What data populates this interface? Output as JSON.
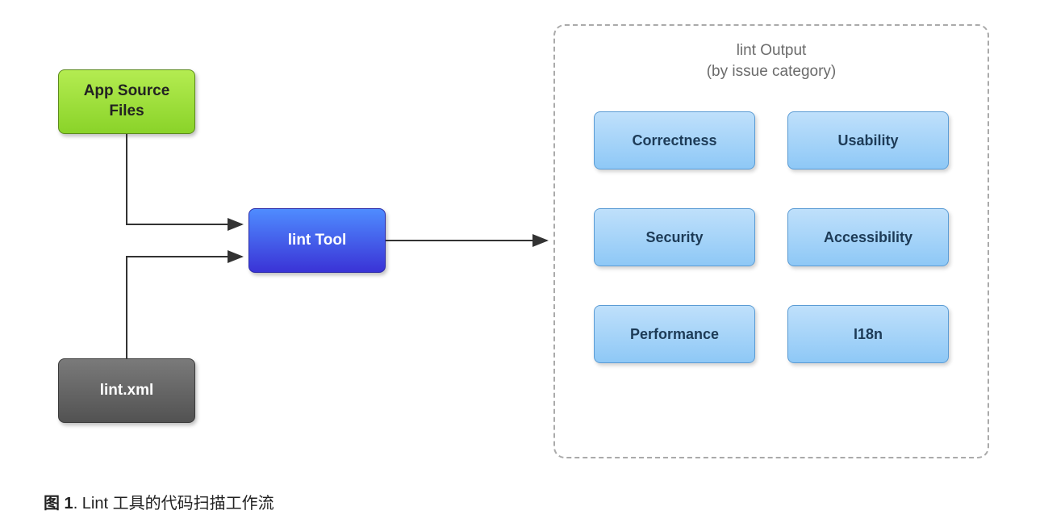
{
  "nodes": {
    "app_source": "App Source\nFiles",
    "lint_xml": "lint.xml",
    "lint_tool": "lint Tool"
  },
  "output": {
    "title_line1": "lint Output",
    "title_line2": "(by issue category)",
    "categories": [
      "Correctness",
      "Usability",
      "Security",
      "Accessibility",
      "Performance",
      "I18n"
    ]
  },
  "caption": {
    "prefix": "图 1",
    "text": ". Lint 工具的代码扫描工作流"
  },
  "colors": {
    "green_top": "#b4ec51",
    "green_bottom": "#8ad329",
    "gray_top": "#7a7a7a",
    "gray_bottom": "#525252",
    "purple_top": "#4f8cff",
    "purple_bottom": "#3a33d6",
    "blue_top": "#bfe0fb",
    "blue_bottom": "#8ec8f6",
    "dashed_border": "#aaaaaa"
  }
}
